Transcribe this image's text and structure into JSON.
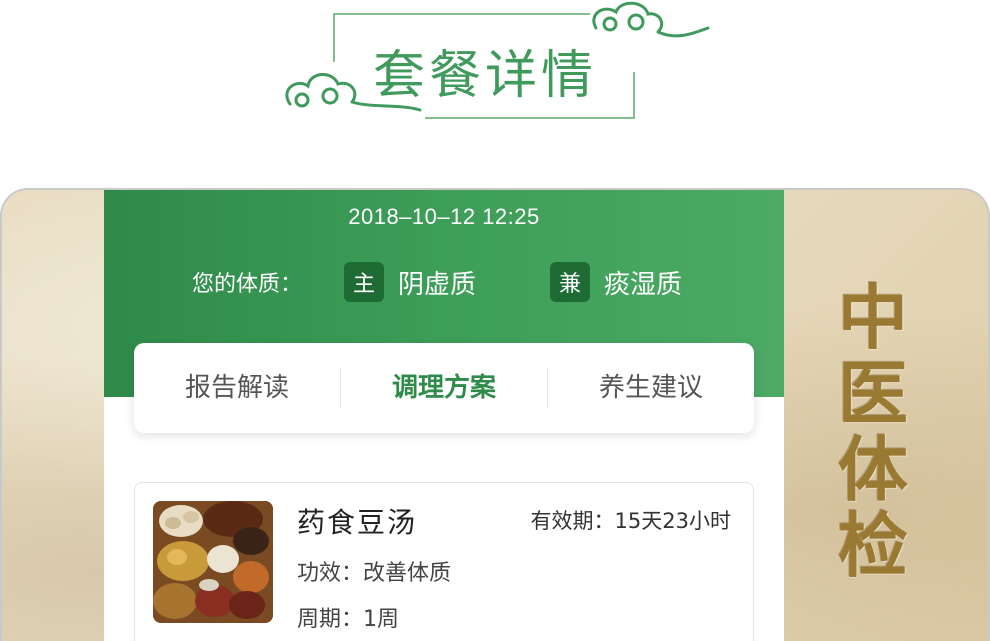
{
  "banner": {
    "title": "套餐详情"
  },
  "side_title": [
    "中",
    "医",
    "体",
    "检"
  ],
  "header": {
    "datetime": "2018–10–12  12:25",
    "constitution_label": "您的体质：",
    "primary": {
      "badge": "主",
      "name": "阴虚质"
    },
    "secondary": {
      "badge": "兼",
      "name": "痰湿质"
    }
  },
  "tabs": [
    {
      "label": "报告解读",
      "active": false
    },
    {
      "label": "调理方案",
      "active": true
    },
    {
      "label": "养生建议",
      "active": false
    }
  ],
  "plan": {
    "name": "药食豆汤",
    "validity": "有效期：15天23小时",
    "effect": "功效：改善体质",
    "cycle": "周期：1周"
  },
  "colors": {
    "accent": "#3d9e58",
    "badge": "#1e6b34",
    "paper": "#e8dcc0",
    "side_title": "#9a7a32"
  }
}
